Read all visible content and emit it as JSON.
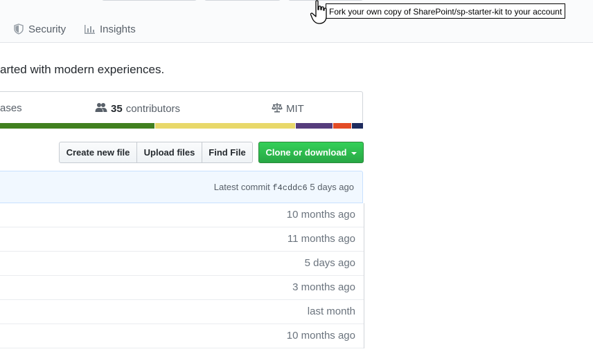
{
  "tabs": [
    {
      "label": "Security",
      "icon": "shield-icon"
    },
    {
      "label": "Insights",
      "icon": "graph-icon"
    }
  ],
  "tooltip": "Fork your own copy of SharePoint/sp-starter-kit to your account",
  "description": "arted with modern experiences.",
  "summary": {
    "releases_label": "ases",
    "contributors_count": "35",
    "contributors_label": "contributors",
    "license": "MIT"
  },
  "language_bar": [
    {
      "color": "#41801f",
      "percent": 44
    },
    {
      "color": "#e8d86a",
      "percent": 38
    },
    {
      "color": "#563d7c",
      "percent": 10
    },
    {
      "color": "#e34c26",
      "percent": 5
    },
    {
      "color": "#1e2b5e",
      "percent": 3
    }
  ],
  "buttons": {
    "create": "Create new file",
    "upload": "Upload files",
    "find": "Find File",
    "clone": "Clone or download"
  },
  "commit": {
    "label": "Latest commit",
    "sha": "f4cddc6",
    "age": "5 days ago"
  },
  "file_rows": [
    {
      "age": "10 months ago"
    },
    {
      "age": "11 months ago"
    },
    {
      "age": "5 days ago"
    },
    {
      "age": "3 months ago"
    },
    {
      "age": "last month"
    },
    {
      "age": "10 months ago"
    }
  ]
}
